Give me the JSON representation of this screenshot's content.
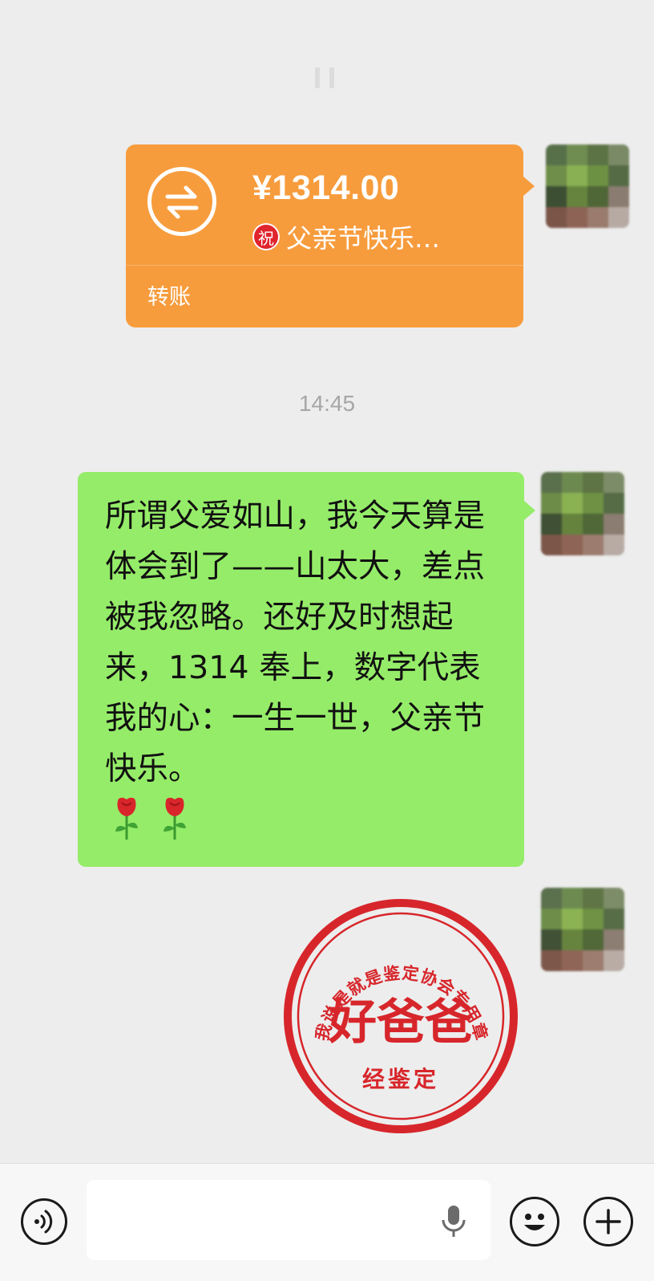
{
  "transfer": {
    "amount": "¥1314.00",
    "badge": "祝",
    "memo": "父亲节快乐…",
    "footer_label": "转账",
    "color": "#f79c3d"
  },
  "timestamp": "14:45",
  "message": {
    "text": "所谓父爱如山，我今天算是体会到了——山太大，差点被我忽略。还好及时想起来，1314 奉上，数字代表我的心：一生一世，父亲节快乐。",
    "emoji": [
      "rose",
      "rose"
    ],
    "color": "#95ec69"
  },
  "stamp": {
    "arc_text": "我说是就是鉴定协会专用章",
    "main_text": "好爸爸",
    "bottom_text": "经鉴定",
    "color": "#d7262b"
  },
  "input_bar": {
    "voice_icon": "voice-icon",
    "mic_icon": "mic-icon",
    "emoji_icon": "emoji-icon",
    "plus_icon": "plus-icon"
  }
}
